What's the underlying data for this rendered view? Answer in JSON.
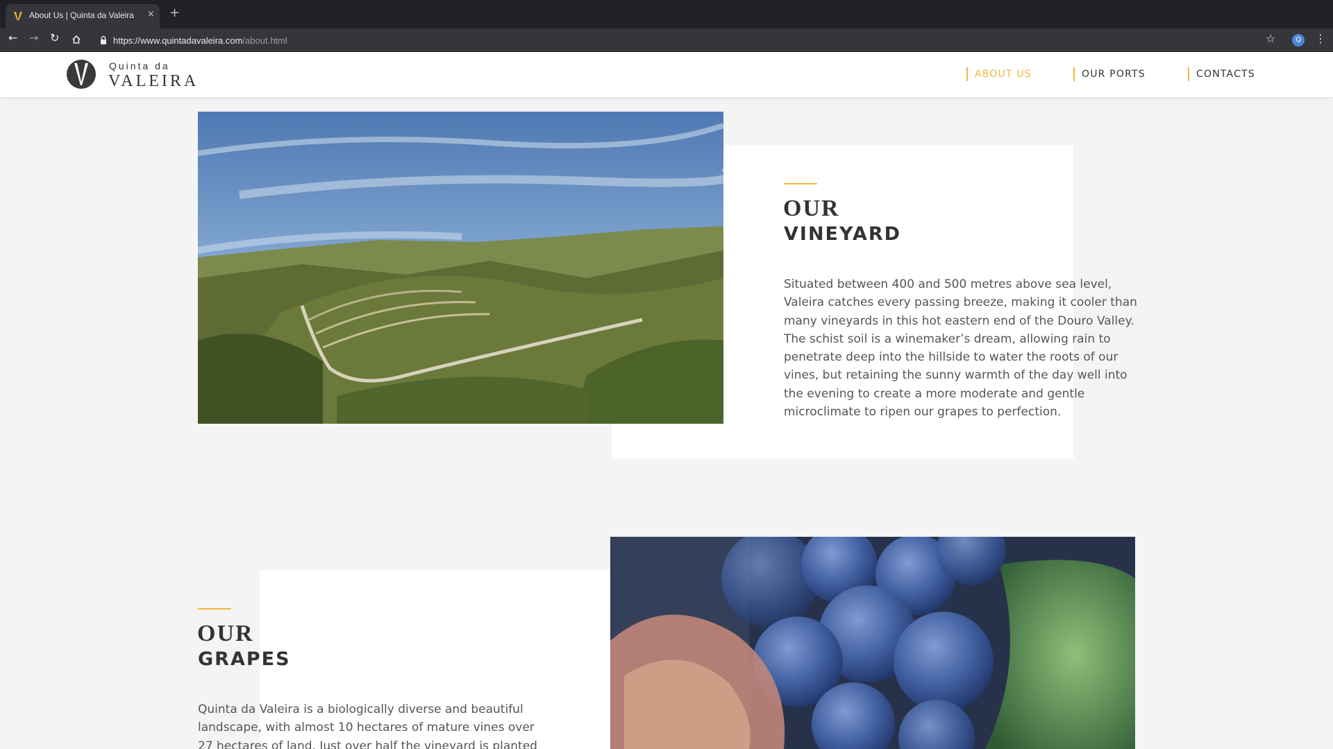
{
  "browser": {
    "tab_title": "About Us | Quinta da Valeira",
    "tab_close": "×",
    "new_tab": "+",
    "url_domain": "https://www.quintadavaleira.com",
    "url_path": "/about.html",
    "profile_initial": "Q"
  },
  "site": {
    "logo_line1": "Quinta da",
    "logo_line2": "VALEIRA",
    "accent_color": "#f2b53a",
    "nav": [
      {
        "label": "ABOUT US",
        "active": true
      },
      {
        "label": "OUR PORTS",
        "active": false
      },
      {
        "label": "CONTACTS",
        "active": false
      }
    ]
  },
  "sections": {
    "vineyard": {
      "heading_line1": "OUR",
      "heading_line2": "VINEYARD",
      "body": "Situated between 400 and 500 metres above sea level, Valeira catches every passing breeze, making it cooler than many vineyards in this hot eastern end of the Douro Valley. The schist soil is a winemaker’s dream, allowing rain to penetrate deep into the hillside to water the roots of our vines, but retaining the sunny warmth of the day well into the evening to create a more moderate and gentle microclimate to ripen our grapes to perfection."
    },
    "grapes": {
      "heading_line1": "OUR",
      "heading_line2": "GRAPES",
      "body": "Quinta da Valeira is a biologically diverse and beautiful landscape, with almost 10 hectares of mature vines over 27 hectares of land. Just over half the vineyard is planted with"
    }
  }
}
